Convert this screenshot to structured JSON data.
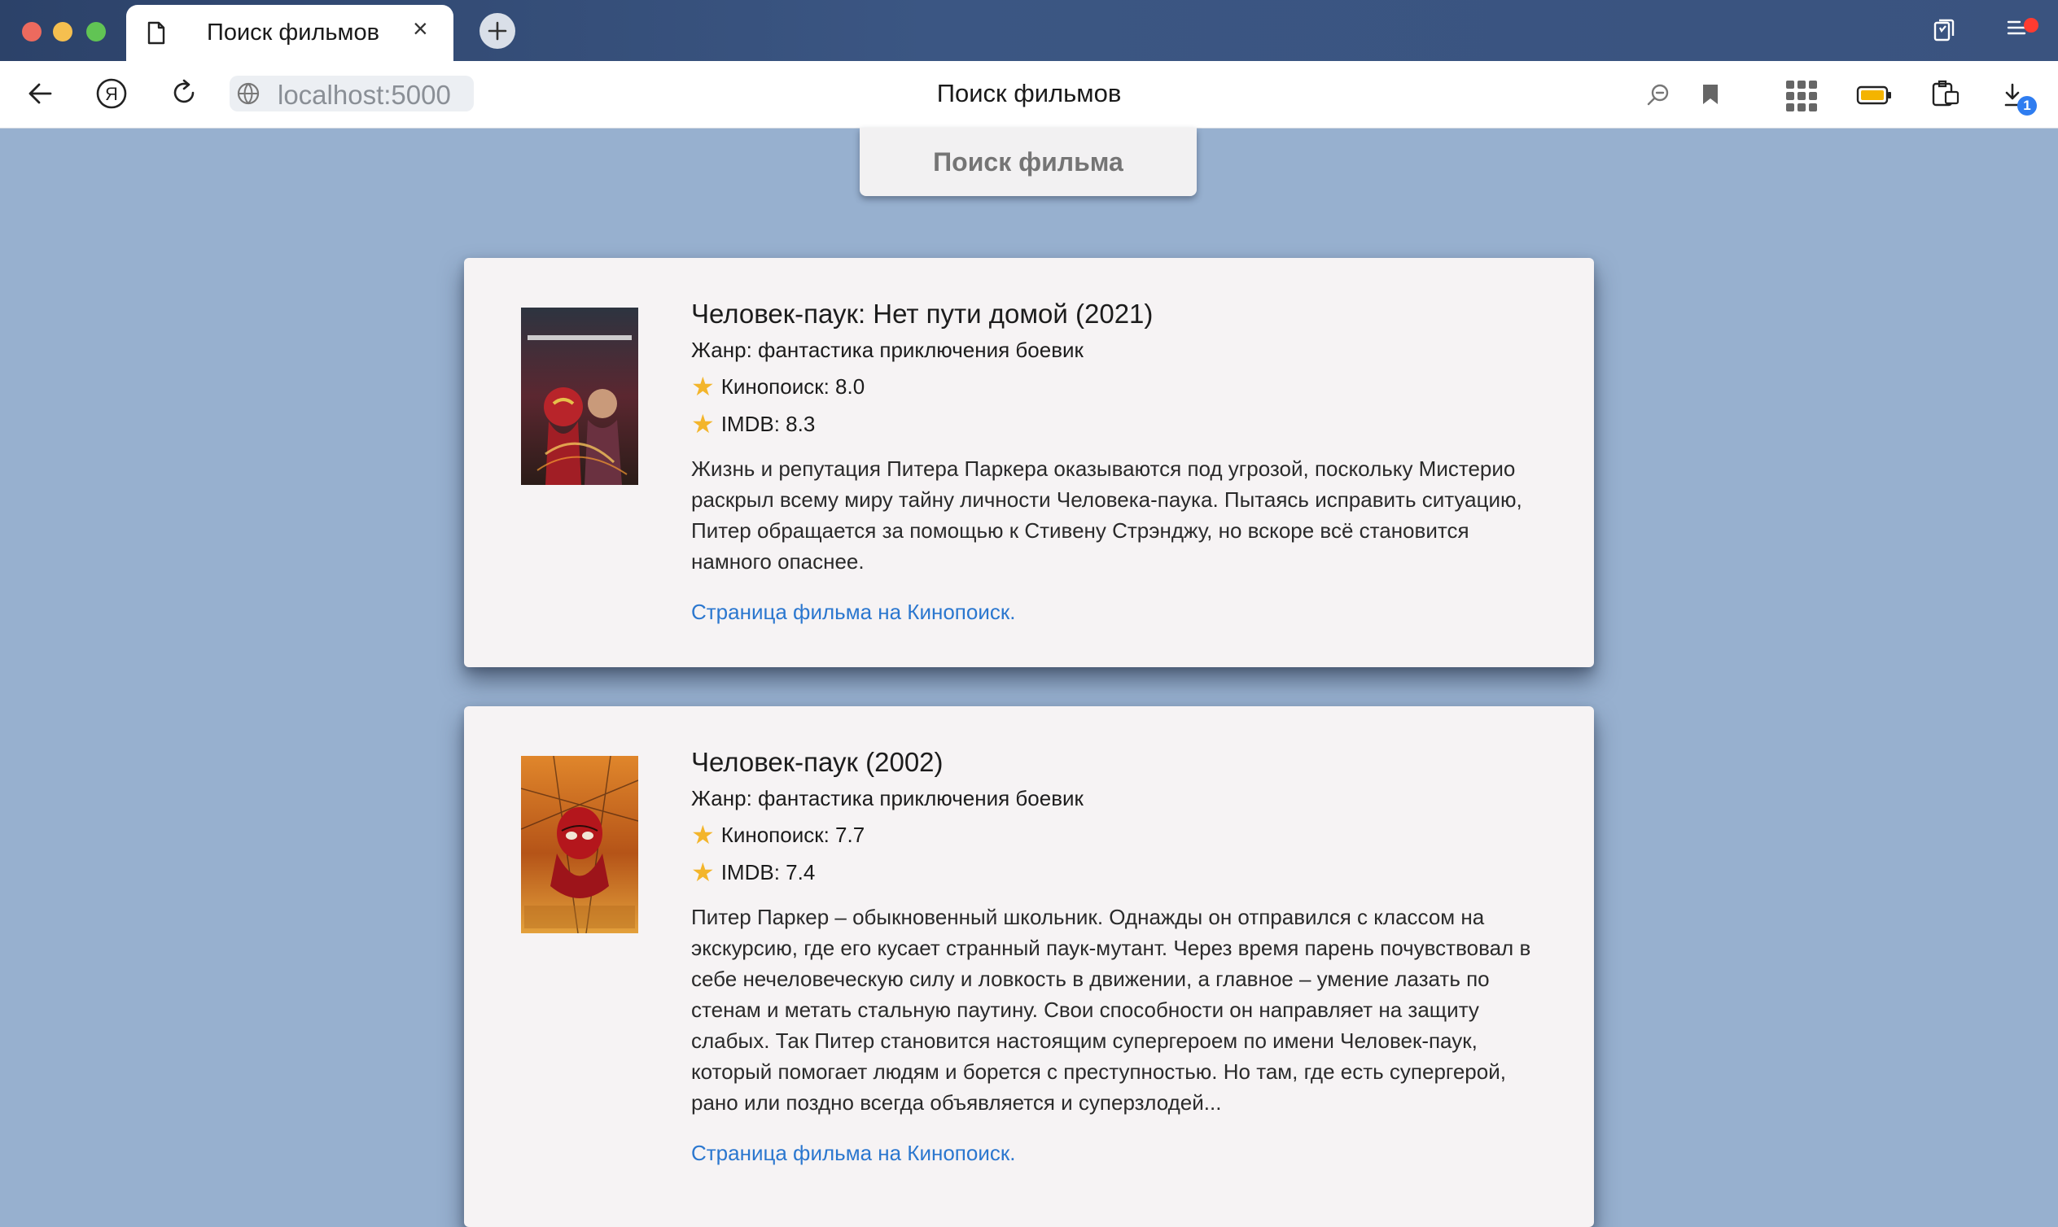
{
  "browser": {
    "tab_title": "Поиск фильмов",
    "tab_close": "×",
    "address": "localhost:5000",
    "page_title": "Поиск фильмов",
    "downloads_badge": "1"
  },
  "page": {
    "search_button": "Поиск фильма"
  },
  "movies": [
    {
      "title": "Человек-паук: Нет пути домой (2021)",
      "genre": "Жанр: фантастика приключения боевик",
      "kinopoisk": "Кинопоиск: 8.0",
      "imdb": "IMDB: 8.3",
      "description": "Жизнь и репутация Питера Паркера оказываются под угрозой, поскольку Мистерио раскрыл всему миру тайну личности Человека-паука. Пытаясь исправить ситуацию, Питер обращается за помощью к Стивену Стрэнджу, но вскоре всё становится намного опаснее.",
      "link": "Страница фильма на Кинопоиск."
    },
    {
      "title": "Человек-паук (2002)",
      "genre": "Жанр: фантастика приключения боевик",
      "kinopoisk": "Кинопоиск: 7.7",
      "imdb": "IMDB: 7.4",
      "description": "Питер Паркер – обыкновенный школьник. Однажды он отправился с классом на экскурсию, где его кусает странный паук-мутант. Через время парень почувствовал в себе нечеловеческую силу и ловкость в движении, а главное – умение лазать по стенам и метать стальную паутину. Свои способности он направляет на защиту слабых. Так Питер становится настоящим супергероем по имени Человек-паук, который помогает людям и борется с преступностью. Но там, где есть супергерой, рано или поздно всегда объявляется и суперзлодей...",
      "link": "Страница фильма на Кинопоиск."
    }
  ],
  "colors": {
    "page_background": "#97b0cf",
    "card_background": "#f6f3f4",
    "link": "#2b77cf",
    "star": "#f3b52b"
  },
  "icons": [
    "document-icon",
    "close-icon",
    "plus-icon",
    "collections-icon",
    "menu-icon",
    "back-arrow-icon",
    "yandex-icon",
    "reload-icon",
    "globe-icon",
    "zoom-icon",
    "bookmark-icon",
    "apps-grid-icon",
    "battery-icon",
    "clipboard-icon",
    "download-icon",
    "star-icon",
    "spiderman-poster-2021",
    "spiderman-poster-2002"
  ]
}
